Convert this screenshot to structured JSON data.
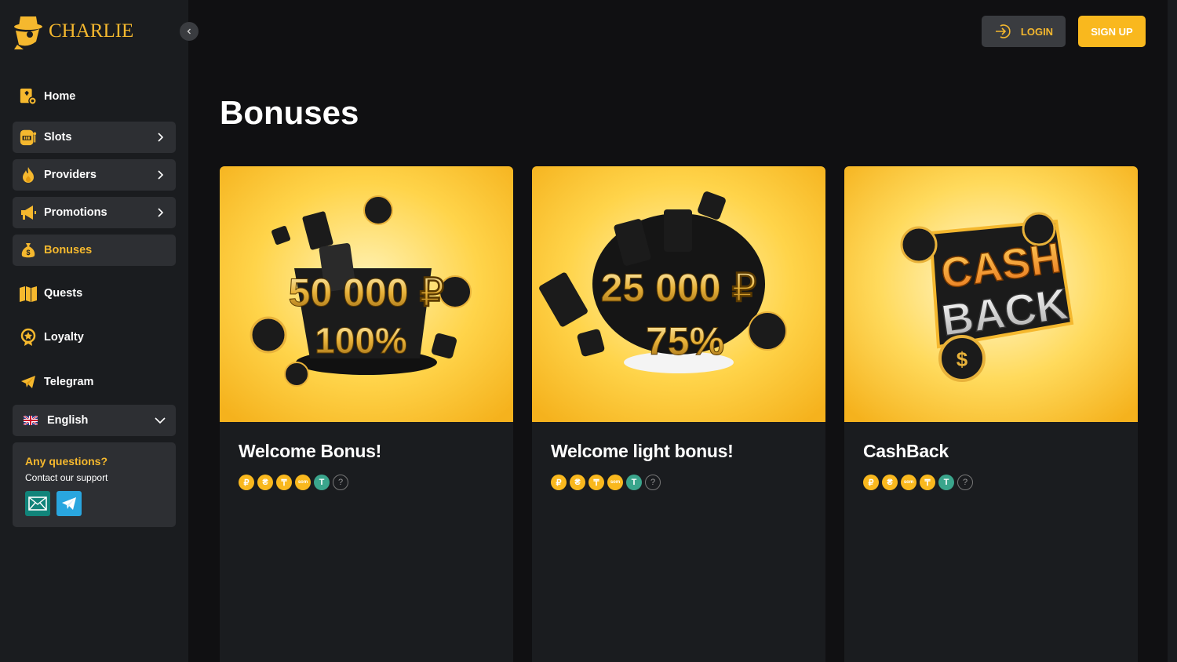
{
  "brand": {
    "name": "CHARLIE",
    "accent": "#f5b82e"
  },
  "sidebar": {
    "collapse_icon": "chevron-left-icon",
    "items": [
      {
        "label": "Home",
        "icon": "home-icon",
        "style": "plain"
      },
      {
        "label": "Slots",
        "icon": "slot-machine-icon",
        "style": "boxed",
        "chevron": true
      },
      {
        "label": "Providers",
        "icon": "fire-icon",
        "style": "boxed",
        "chevron": true
      },
      {
        "label": "Promotions",
        "icon": "megaphone-icon",
        "style": "boxed",
        "chevron": true
      },
      {
        "label": "Bonuses",
        "icon": "money-bag-icon",
        "style": "active"
      },
      {
        "label": "Quests",
        "icon": "map-icon",
        "style": "plain"
      },
      {
        "label": "Loyalty",
        "icon": "medal-icon",
        "style": "plain"
      },
      {
        "label": "Telegram",
        "icon": "telegram-icon",
        "style": "plain"
      }
    ],
    "language": {
      "label": "English",
      "flag": "uk-flag-icon"
    },
    "support": {
      "title": "Any questions?",
      "subtitle": "Contact our support"
    }
  },
  "header": {
    "login_label": "LOGIN",
    "signup_label": "SIGN UP"
  },
  "main": {
    "title": "Bonuses",
    "cards": [
      {
        "title": "Welcome Bonus!",
        "image_amount": "50 000 ₽",
        "image_percent": "100%",
        "coins": [
          "₽",
          "₴",
          "₸",
          "som",
          "T",
          "?"
        ]
      },
      {
        "title": "Welcome light bonus!",
        "image_amount": "25 000 ₽",
        "image_percent": "75%",
        "coins": [
          "₽",
          "₴",
          "₸",
          "som",
          "T",
          "?"
        ]
      },
      {
        "title": "CashBack",
        "image_line1": "CASH",
        "image_line2": "BACK",
        "coins": [
          "₽",
          "₴",
          "som",
          "₸",
          "T",
          "?"
        ]
      }
    ]
  }
}
